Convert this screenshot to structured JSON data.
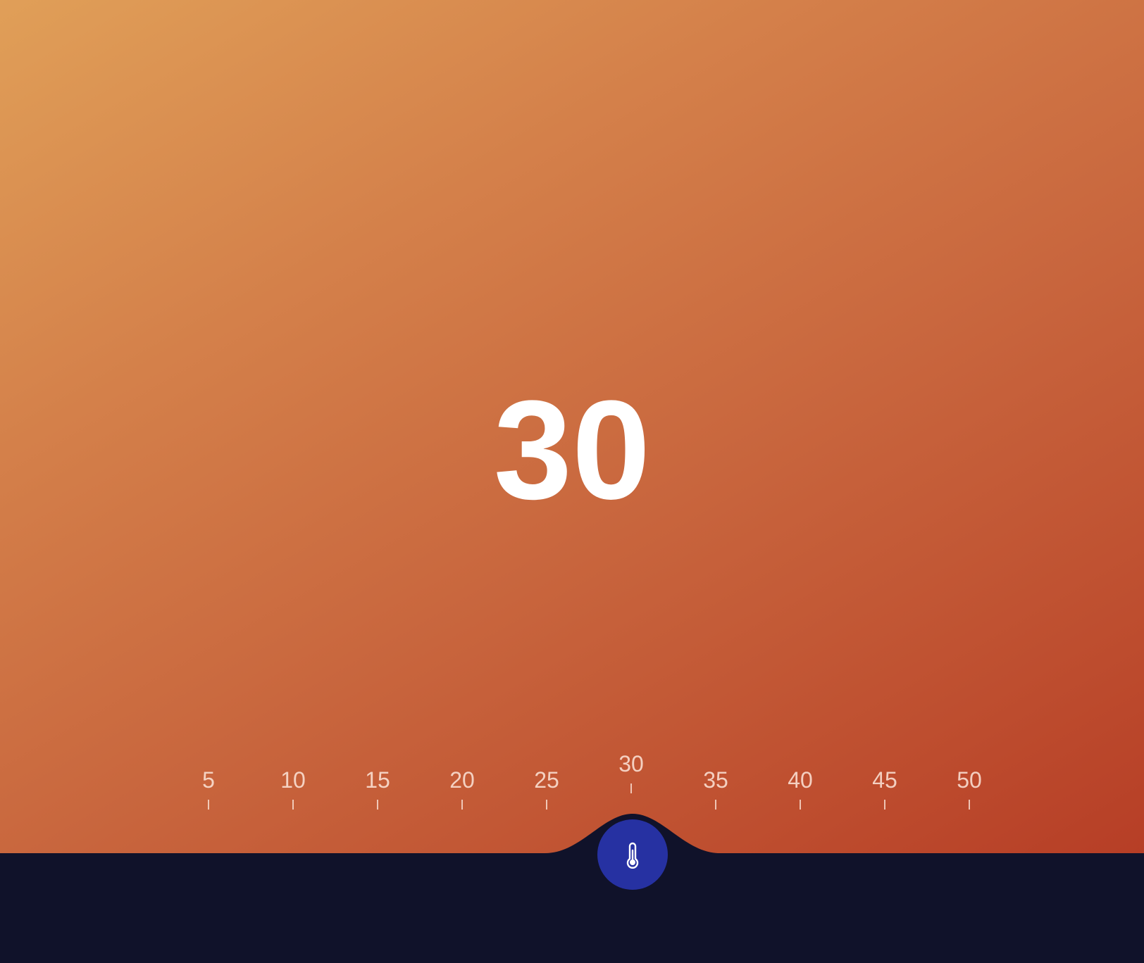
{
  "display": {
    "current_value": "30"
  },
  "scale": {
    "min": 5,
    "max": 50,
    "step": 5,
    "selected": 30,
    "ticks": [
      "5",
      "10",
      "15",
      "20",
      "25",
      "30",
      "35",
      "40",
      "45",
      "50"
    ]
  },
  "slider": {
    "handle_icon": "thermometer-icon"
  },
  "colors": {
    "background_top": "#e09f58",
    "background_bottom": "#b33722",
    "base": "#10122a",
    "handle": "#2631a2",
    "value_text": "#ffffff"
  }
}
